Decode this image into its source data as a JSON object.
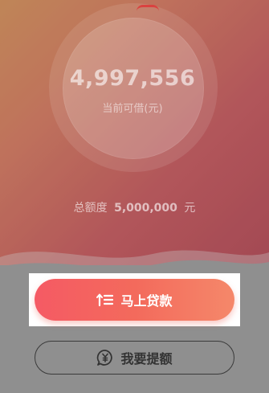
{
  "credit": {
    "available_amount": "4,997,556",
    "available_caption": "当前可借(元)",
    "total_label": "总额度",
    "total_value": "5,000,000",
    "total_unit": "元"
  },
  "actions": {
    "borrow_label": "马上贷款",
    "borrow_icon": "list-up-arrow-icon",
    "raise_label": "我要提额",
    "raise_icon": "yen-chat-icon"
  },
  "colors": {
    "primary_start": "#f55a64",
    "primary_end": "#f5886a",
    "hero_top": "#c9824a",
    "hero_bottom": "#a63845"
  }
}
